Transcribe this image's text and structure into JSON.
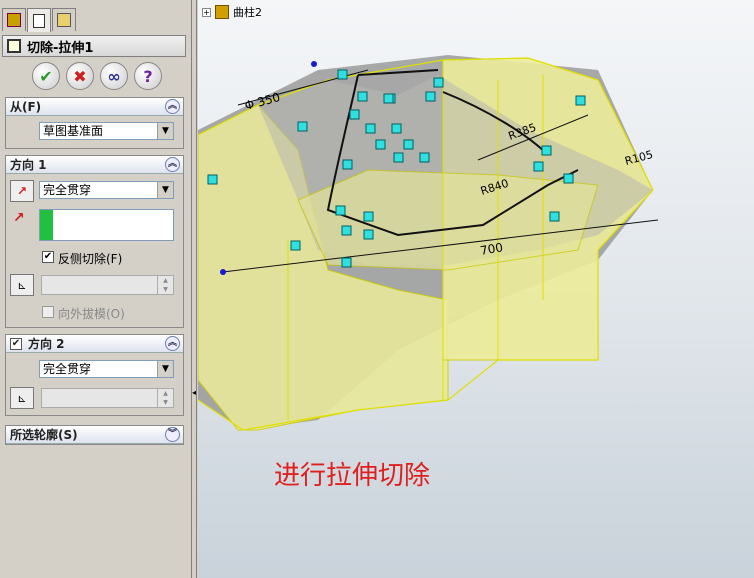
{
  "tree": {
    "item_label": "曲柱2"
  },
  "feature": {
    "title": "切除-拉伸1"
  },
  "actions": {
    "ok": "✔",
    "cancel": "✖",
    "detail": "∞",
    "help": "?"
  },
  "from": {
    "header": "从(F)",
    "value": "草图基准面"
  },
  "direction1": {
    "header": "方向 1",
    "end_condition": "完全贯穿",
    "flip_side_label": "反侧切除(F)",
    "flip_side_checked": true,
    "draft_label": "向外拔模(O)",
    "draft_checked": false
  },
  "direction2": {
    "header": "方向 2",
    "enabled": true,
    "end_condition": "完全贯穿"
  },
  "selected_contours": {
    "header": "所选轮廓(S)"
  },
  "sketch": {
    "dimensions": [
      "Φ 350",
      "R385",
      "R105",
      "R840",
      "700"
    ]
  },
  "caption": "进行拉伸切除",
  "colors": {
    "accent_red": "#e0201e",
    "model_yellow": "#f0f0a0",
    "sketch_blue": "#1a1ad0"
  }
}
